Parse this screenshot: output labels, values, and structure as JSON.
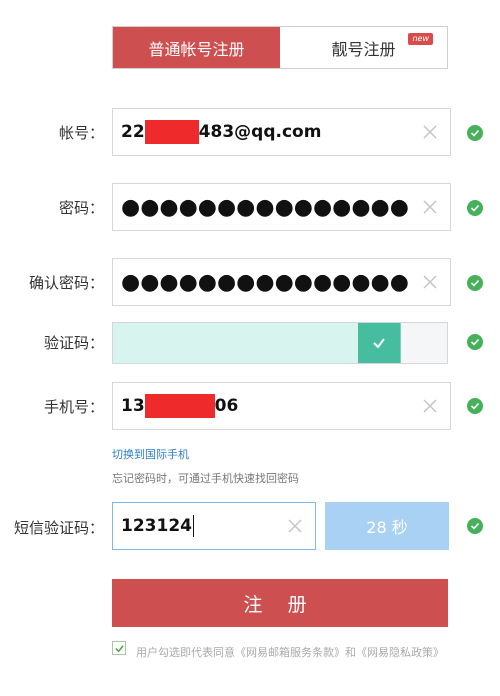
{
  "tabs": {
    "normal_label": "普通帐号注册",
    "vip_label": "靓号注册",
    "new_badge": "new"
  },
  "account": {
    "label": "帐号：",
    "value_prefix": "22",
    "value_suffix": "483@qq.com"
  },
  "password": {
    "label": "密码：",
    "value": "●●●●●●●●●●●●●●●"
  },
  "confirm_password": {
    "label": "确认密码：",
    "value": "●●●●●●●●●●●●●●●"
  },
  "captcha": {
    "label": "验证码：",
    "progress": 0.84
  },
  "phone": {
    "label": "手机号：",
    "value_prefix": "13",
    "value_suffix": "06",
    "intl_link": "切换到国际手机",
    "hint": "忘记密码时，可通过手机快速找回密码"
  },
  "sms": {
    "label": "短信验证码：",
    "value": "123124",
    "countdown": "28 秒"
  },
  "submit_label": "注 册",
  "agreement": "用户勾选即代表同意《网易邮箱服务条款》和《网易隐私政策》",
  "colors": {
    "brand_red": "#cd4f4f",
    "ok_green": "#47b05a",
    "captcha_green": "#46bd9f",
    "countdown_blue": "#a9d1f3",
    "link_blue": "#2c7fc6"
  },
  "icons": {
    "clear": "close-icon",
    "valid": "check-circle-icon",
    "captcha_handle": "check-icon",
    "checkbox": "check-icon"
  }
}
